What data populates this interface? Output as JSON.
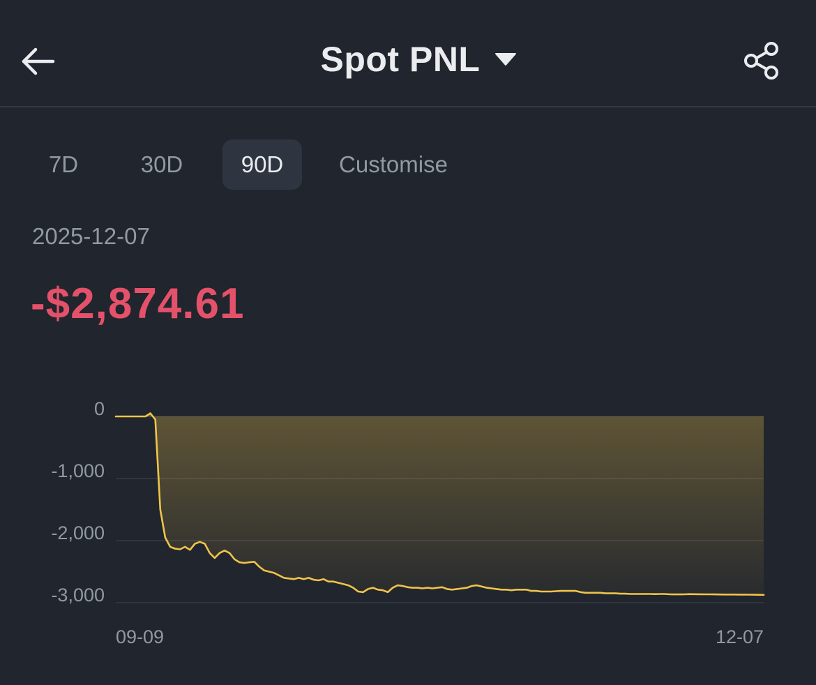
{
  "header": {
    "title": "Spot PNL",
    "back_icon": "arrow-left-icon",
    "dropdown_icon": "caret-down-icon",
    "share_icon": "share-icon"
  },
  "tabs": [
    {
      "label": "7D",
      "active": false
    },
    {
      "label": "30D",
      "active": false
    },
    {
      "label": "90D",
      "active": true
    },
    {
      "label": "Customise",
      "active": false
    }
  ],
  "summary": {
    "date": "2025-12-07",
    "value": "-$2,874.61"
  },
  "colors": {
    "background": "#21252d",
    "line": "#f0c44a",
    "negative": "#e4516a",
    "muted_text": "#9199a4",
    "active_tab_bg": "#2f3540"
  },
  "chart_data": {
    "type": "area",
    "ylim": [
      -3000,
      0
    ],
    "yticks": [
      0,
      -1000,
      -2000,
      -3000
    ],
    "ytick_labels": [
      "0",
      "-1,000",
      "-2,000",
      "-3,000"
    ],
    "xtick_labels": [
      "09-09",
      "12-07"
    ],
    "x_range": [
      "2025-09-09",
      "2025-12-07"
    ],
    "grid": true,
    "series": [
      {
        "values": [
          0,
          0,
          0,
          0,
          0,
          0,
          0,
          50,
          -50,
          -1500,
          -1950,
          -2100,
          -2130,
          -2140,
          -2100,
          -2150,
          -2050,
          -2020,
          -2050,
          -2200,
          -2280,
          -2200,
          -2160,
          -2200,
          -2300,
          -2350,
          -2360,
          -2350,
          -2340,
          -2420,
          -2480,
          -2500,
          -2520,
          -2560,
          -2600,
          -2610,
          -2620,
          -2600,
          -2620,
          -2600,
          -2630,
          -2640,
          -2620,
          -2660,
          -2660,
          -2680,
          -2700,
          -2720,
          -2760,
          -2820,
          -2830,
          -2780,
          -2760,
          -2790,
          -2800,
          -2830,
          -2760,
          -2720,
          -2730,
          -2750,
          -2760,
          -2760,
          -2770,
          -2760,
          -2770,
          -2760,
          -2750,
          -2780,
          -2790,
          -2780,
          -2770,
          -2760,
          -2730,
          -2720,
          -2740,
          -2760,
          -2770,
          -2780,
          -2790,
          -2790,
          -2800,
          -2790,
          -2790,
          -2790,
          -2810,
          -2810,
          -2820,
          -2820,
          -2820,
          -2815,
          -2810,
          -2810,
          -2810,
          -2810,
          -2830,
          -2840,
          -2840,
          -2840,
          -2840,
          -2850,
          -2850,
          -2850,
          -2855,
          -2855,
          -2860,
          -2860,
          -2860,
          -2860,
          -2860,
          -2862,
          -2860,
          -2860,
          -2865,
          -2866,
          -2866,
          -2865,
          -2862,
          -2863,
          -2864,
          -2865,
          -2865,
          -2866,
          -2867,
          -2868,
          -2868,
          -2869,
          -2870,
          -2870,
          -2871,
          -2872,
          -2873,
          -2874.61
        ]
      }
    ]
  }
}
